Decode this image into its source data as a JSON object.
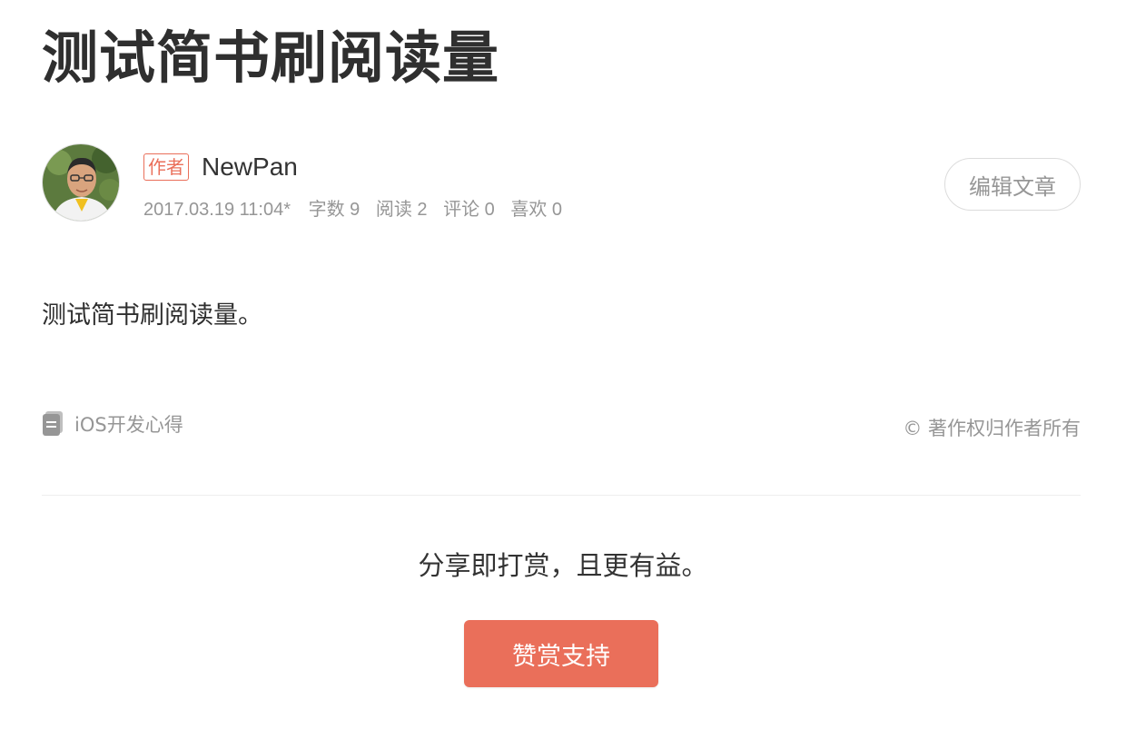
{
  "article": {
    "title": "测试简书刷阅读量",
    "body": "测试简书刷阅读量。"
  },
  "author": {
    "tag": "作者",
    "name": "NewPan",
    "avatar_icon": "user-photo-avatar"
  },
  "meta": {
    "date": "2017.03.19 11:04*",
    "word_count": "字数 9",
    "views": "阅读 2",
    "comments": "评论 0",
    "likes": "喜欢 0"
  },
  "actions": {
    "edit_label": "编辑文章",
    "support_label": "赞赏支持"
  },
  "footer": {
    "collection_icon": "notebook-icon",
    "collection_label": "iOS开发心得",
    "copyright": "© 著作权归作者所有"
  },
  "reward": {
    "share_text": "分享即打赏，且更有益。"
  },
  "colors": {
    "accent": "#ea6f5a",
    "muted_text": "#969696",
    "primary_text": "#333333",
    "divider": "#eeeeee"
  }
}
